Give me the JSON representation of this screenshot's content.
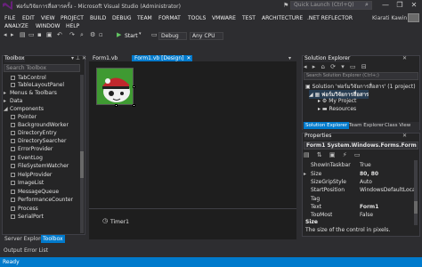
{
  "window": {
    "title": "ฟอร์มวิจัยการสื่อสารครั้ง - Microsoft Visual Studio (Administrator)",
    "quick_launch_placeholder": "Quick Launch (Ctrl+Q)",
    "controls": [
      "—",
      "❐",
      "✕"
    ]
  },
  "menu": {
    "row1": [
      "FILE",
      "EDIT",
      "VIEW",
      "PROJECT",
      "BUILD",
      "DEBUG",
      "TEAM",
      "FORMAT",
      "TOOLS",
      "VMWARE",
      "TEST",
      "ARCHITECTURE",
      ".NET REFLECTOR"
    ],
    "row2": [
      "ANALYZE",
      "WINDOW",
      "HELP"
    ],
    "user": "Kiarati Kawin"
  },
  "toolbar": {
    "start_label": "Start",
    "config": "Debug",
    "platform": "Any CPU"
  },
  "toolbox": {
    "title": "Toolbox",
    "search_placeholder": "Search Toolbox",
    "items": [
      {
        "label": "TabControl",
        "type": "item"
      },
      {
        "label": "TableLayoutPanel",
        "type": "item"
      },
      {
        "label": "Menus & Toolbars",
        "type": "group-collapsed"
      },
      {
        "label": "Data",
        "type": "group-collapsed"
      },
      {
        "label": "Components",
        "type": "group-expanded"
      },
      {
        "label": "Pointer",
        "type": "item"
      },
      {
        "label": "BackgroundWorker",
        "type": "item"
      },
      {
        "label": "DirectoryEntry",
        "type": "item"
      },
      {
        "label": "DirectorySearcher",
        "type": "item"
      },
      {
        "label": "ErrorProvider",
        "type": "item"
      },
      {
        "label": "EventLog",
        "type": "item"
      },
      {
        "label": "FileSystemWatcher",
        "type": "item"
      },
      {
        "label": "HelpProvider",
        "type": "item"
      },
      {
        "label": "ImageList",
        "type": "item"
      },
      {
        "label": "MessageQueue",
        "type": "item"
      },
      {
        "label": "PerformanceCounter",
        "type": "item"
      },
      {
        "label": "Process",
        "type": "item"
      },
      {
        "label": "SerialPort",
        "type": "item"
      }
    ],
    "bottom_tabs": [
      "Server Explorer",
      "Toolbox"
    ]
  },
  "documents": {
    "tabs": [
      "Form1.vb",
      "Form1.vb [Design]"
    ],
    "tray_component": "Timer1"
  },
  "solution_explorer": {
    "title": "Solution Explorer",
    "search_placeholder": "Search Solution Explorer (Ctrl+;)",
    "nodes": [
      "Solution 'ฟอร์มวิจัยการสื่อสาร' (1 project)",
      "ฟอร์มวิจัยการสื่อสาร",
      "My Project",
      "Resources"
    ],
    "tabs": [
      "Solution Explorer",
      "Team Explorer",
      "Class View"
    ]
  },
  "properties": {
    "title": "Properties",
    "object": "Form1 System.Windows.Forms.Form",
    "rows": [
      {
        "name": "ShowInTaskbar",
        "value": "True"
      },
      {
        "name": "Size",
        "value": "80, 80"
      },
      {
        "name": "SizeGripStyle",
        "value": "Auto"
      },
      {
        "name": "StartPosition",
        "value": "WindowsDefaultLocati"
      },
      {
        "name": "Tag",
        "value": ""
      },
      {
        "name": "Text",
        "value": "Form1"
      },
      {
        "name": "TopMost",
        "value": "False"
      }
    ],
    "desc_title": "Size",
    "desc_text": "The size of the control in pixels."
  },
  "bottom": {
    "tabs": [
      "Output",
      "Error List"
    ],
    "status": "Ready"
  }
}
